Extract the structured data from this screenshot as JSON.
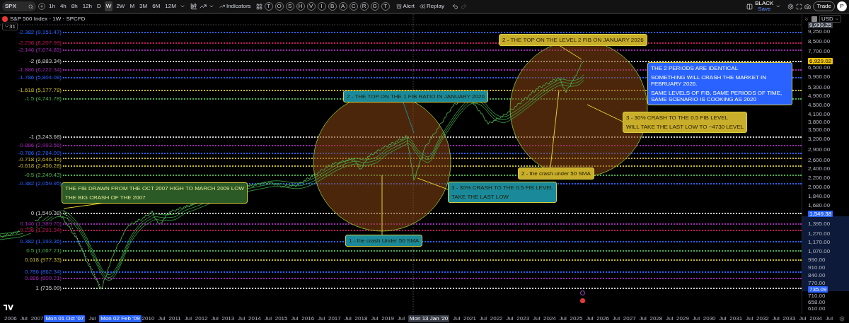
{
  "toolbar": {
    "symbol": "SPX",
    "intervals": [
      {
        "label": "1h",
        "selected": false
      },
      {
        "label": "4h",
        "selected": false
      },
      {
        "label": "8h",
        "selected": false
      },
      {
        "label": "12h",
        "selected": false
      },
      {
        "label": "D",
        "selected": false
      },
      {
        "label": "W",
        "selected": true
      },
      {
        "label": "2W",
        "selected": false
      },
      {
        "label": "M",
        "selected": false
      },
      {
        "label": "3M",
        "selected": false
      },
      {
        "label": "6M",
        "selected": false
      },
      {
        "label": "12M",
        "selected": false
      }
    ],
    "indicators": "Indicators",
    "templates": [
      "T",
      "O",
      "S",
      "H",
      "V",
      "I",
      "B",
      "A",
      "C",
      "R",
      "G",
      "T"
    ],
    "alert": "Alert",
    "replay": "Replay",
    "layout": {
      "name": "BLACK",
      "status": "Save"
    },
    "trade": "Trade",
    "avatar": "P"
  },
  "legend": {
    "title": "S&P 500 Index · 1W · SPCFD",
    "count": "31"
  },
  "fib_levels": [
    {
      "label": "-2.382 (9,151.47)",
      "color": "#2962ff"
    },
    {
      "label": "-2.236 (8,207.99)",
      "color": "#c2185b"
    },
    {
      "label": "-2.146 (7,674.85)",
      "color": "#9c27b0"
    },
    {
      "label": "-2 (6,883.34)",
      "color": "#cccccc"
    },
    {
      "label": "-1.886 (6,222.34)",
      "color": "#9c27b0"
    },
    {
      "label": "-1.786 (5,804.08)",
      "color": "#2962ff"
    },
    {
      "label": "-1.618 (5,177.78)",
      "color": "#c9b92b"
    },
    {
      "label": "-1.5 (4,741.78)",
      "color": "#4caf50"
    },
    {
      "label": "-1 (3,243.68)",
      "color": "#cccccc"
    },
    {
      "label": "-0.886 (2,993.56)",
      "color": "#9c27b0"
    },
    {
      "label": "-0.786 (2,784.09)",
      "color": "#2962ff"
    },
    {
      "label": "-0.718 (2,646.45)",
      "color": "#c9b92b"
    },
    {
      "label": "-0.618 (2,456.28)",
      "color": "#c9b92b"
    },
    {
      "label": "-0.5 (2,249.43)",
      "color": "#4caf50"
    },
    {
      "label": "-0.382 (2,059.95)",
      "color": "#2962ff"
    },
    {
      "label": "0 (1,549.38)",
      "color": "#cccccc"
    },
    {
      "label": "0.146 (1,389.70)",
      "color": "#9c27b0"
    },
    {
      "label": "0.236 (1,291.34)",
      "color": "#c2185b"
    },
    {
      "label": "0.382 (1,193.36)",
      "color": "#2962ff"
    },
    {
      "label": "0.5 (1,067.21)",
      "color": "#4caf50"
    },
    {
      "label": "0.618 (977.33)",
      "color": "#c9b92b"
    },
    {
      "label": "0.786 (862.34)",
      "color": "#2962ff"
    },
    {
      "label": "0.886 (800.21)",
      "color": "#9c27b0"
    },
    {
      "label": "1 (735.09)",
      "color": "#cccccc"
    }
  ],
  "annotations": [
    {
      "lines": [
        "2 - THE TOP ON THE LEVEL 2 FIB ON JANUARY 2026"
      ],
      "color": "#c8ae2a",
      "kind": "dark"
    },
    {
      "lines": [
        "THE 2 PERIODS ARE IDENTICAL",
        "SOMETHING WILL CRASH THE MARKET IN FEBRUARY 2026.",
        "SAME LEVELS OF FIB, SAME PERIODS OF TIME, SAME SCENARIO IS COOKING AS 2020"
      ],
      "color": "#2962ff",
      "kind": "light"
    },
    {
      "lines": [
        "3 - 30% CRASH TO THE 0.5 FIB LEVEL",
        "WILL TAKE THE LAST LOW TO ~4730 LEVEL"
      ],
      "color": "#c8ae2a",
      "kind": "dark"
    },
    {
      "lines": [
        "2 - the crash under 50 SMA"
      ],
      "color": "#c8ae2a",
      "kind": "dark"
    },
    {
      "lines": [
        "2 - THE TOP ON THE 1 FIB RATIO IN JANUARY 2020"
      ],
      "color": "#1a8a9a",
      "kind": "dark"
    },
    {
      "lines": [
        "THE FIB DRAWN FROM THE OCT 2007 HIGH TO MARCH 2009 LOW",
        "THE BIG CRASH OF THE 2007"
      ],
      "color": "#2c5a26",
      "kind": "pale"
    },
    {
      "lines": [
        "3 - 30% CRASH TO THE 0.5 FIB LEVEL",
        "TAKE THE LAST LOW"
      ],
      "color": "#1a8a9a",
      "kind": "dark"
    },
    {
      "lines": [
        "1 - the crash Under 50 SMA"
      ],
      "color": "#1a8a9a",
      "kind": "dark"
    }
  ],
  "price_axis": {
    "currency": "USD",
    "labels": [
      {
        "text": "9,930.25",
        "kind": "crosshair"
      },
      {
        "text": "9,250.00",
        "kind": "tick"
      },
      {
        "text": "8,500.00",
        "kind": "tick"
      },
      {
        "text": "7,700.00",
        "kind": "tick"
      },
      {
        "text": "6,929.02",
        "kind": "last"
      },
      {
        "text": "6,500.00",
        "kind": "tick"
      },
      {
        "text": "5,900.00",
        "kind": "tick"
      },
      {
        "text": "5,300.00",
        "kind": "tick"
      },
      {
        "text": "4,900.00",
        "kind": "tick"
      },
      {
        "text": "4,500.00",
        "kind": "tick"
      },
      {
        "text": "4,100.00",
        "kind": "tick"
      },
      {
        "text": "3,800.00",
        "kind": "tick"
      },
      {
        "text": "3,500.00",
        "kind": "tick"
      },
      {
        "text": "3,200.00",
        "kind": "tick"
      },
      {
        "text": "2,900.00",
        "kind": "tick"
      },
      {
        "text": "2,600.00",
        "kind": "tick"
      },
      {
        "text": "2,400.00",
        "kind": "tick"
      },
      {
        "text": "2,200.00",
        "kind": "tick"
      },
      {
        "text": "2,000.00",
        "kind": "tick"
      },
      {
        "text": "1,840.00",
        "kind": "tick"
      },
      {
        "text": "1,680.00",
        "kind": "tick"
      },
      {
        "text": "1,549.38",
        "kind": "marker"
      },
      {
        "text": "1,395.00",
        "kind": "tick"
      },
      {
        "text": "1,270.00",
        "kind": "tick"
      },
      {
        "text": "1,170.00",
        "kind": "tick"
      },
      {
        "text": "1,070.00",
        "kind": "tick"
      },
      {
        "text": "990.00",
        "kind": "tick"
      },
      {
        "text": "910.00",
        "kind": "tick"
      },
      {
        "text": "840.00",
        "kind": "tick"
      },
      {
        "text": "770.00",
        "kind": "tick"
      },
      {
        "text": "735.09",
        "kind": "marker"
      },
      {
        "text": "710.00",
        "kind": "tick"
      },
      {
        "text": "658.00",
        "kind": "tick"
      },
      {
        "text": "610.00",
        "kind": "tick"
      }
    ]
  },
  "time_axis": [
    {
      "text": "2006",
      "kind": "tick"
    },
    {
      "text": "Jul",
      "kind": "tick"
    },
    {
      "text": "2007",
      "kind": "tick"
    },
    {
      "text": "Mon 01 Oct '07",
      "kind": "marker"
    },
    {
      "text": "Jul",
      "kind": "tick"
    },
    {
      "text": "Mon 02 Feb '09",
      "kind": "marker"
    },
    {
      "text": "2010",
      "kind": "tick"
    },
    {
      "text": "Jul",
      "kind": "tick"
    },
    {
      "text": "2011",
      "kind": "tick"
    },
    {
      "text": "Jul",
      "kind": "tick"
    },
    {
      "text": "2012",
      "kind": "tick"
    },
    {
      "text": "Jul",
      "kind": "tick"
    },
    {
      "text": "2013",
      "kind": "tick"
    },
    {
      "text": "Jul",
      "kind": "tick"
    },
    {
      "text": "2014",
      "kind": "tick"
    },
    {
      "text": "Jul",
      "kind": "tick"
    },
    {
      "text": "2015",
      "kind": "tick"
    },
    {
      "text": "Jul",
      "kind": "tick"
    },
    {
      "text": "2016",
      "kind": "tick"
    },
    {
      "text": "Jul",
      "kind": "tick"
    },
    {
      "text": "2017",
      "kind": "tick"
    },
    {
      "text": "Jul",
      "kind": "tick"
    },
    {
      "text": "2018",
      "kind": "tick"
    },
    {
      "text": "Jul",
      "kind": "tick"
    },
    {
      "text": "2019",
      "kind": "tick"
    },
    {
      "text": "Jul",
      "kind": "tick"
    },
    {
      "text": "Mon 13 Jan '20",
      "kind": "crosshair"
    },
    {
      "text": "Jul",
      "kind": "tick"
    },
    {
      "text": "2021",
      "kind": "tick"
    },
    {
      "text": "Jul",
      "kind": "tick"
    },
    {
      "text": "2022",
      "kind": "tick"
    },
    {
      "text": "Jul",
      "kind": "tick"
    },
    {
      "text": "2023",
      "kind": "tick"
    },
    {
      "text": "Jul",
      "kind": "tick"
    },
    {
      "text": "2024",
      "kind": "tick"
    },
    {
      "text": "Jul",
      "kind": "tick"
    },
    {
      "text": "2025",
      "kind": "tick"
    },
    {
      "text": "Jul",
      "kind": "tick"
    },
    {
      "text": "2026",
      "kind": "tick"
    },
    {
      "text": "Jul",
      "kind": "tick"
    },
    {
      "text": "2027",
      "kind": "tick"
    },
    {
      "text": "Jul",
      "kind": "tick"
    },
    {
      "text": "2028",
      "kind": "tick"
    },
    {
      "text": "Jul",
      "kind": "tick"
    },
    {
      "text": "2029",
      "kind": "tick"
    },
    {
      "text": "Jul",
      "kind": "tick"
    },
    {
      "text": "2030",
      "kind": "tick"
    },
    {
      "text": "Jul",
      "kind": "tick"
    },
    {
      "text": "2031",
      "kind": "tick"
    },
    {
      "text": "Jul",
      "kind": "tick"
    },
    {
      "text": "2032",
      "kind": "tick"
    },
    {
      "text": "Jul",
      "kind": "tick"
    },
    {
      "text": "2033",
      "kind": "tick"
    },
    {
      "text": "Jul",
      "kind": "tick"
    },
    {
      "text": "2034",
      "kind": "tick"
    },
    {
      "text": "Jul",
      "kind": "tick"
    }
  ]
}
